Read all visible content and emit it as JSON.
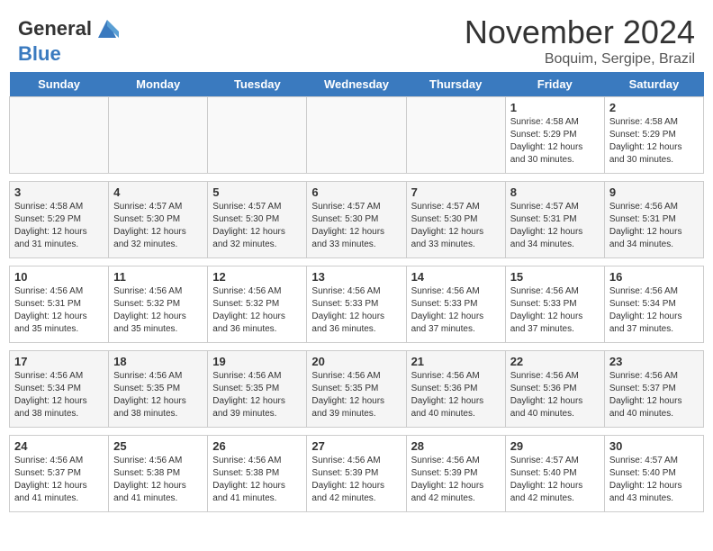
{
  "header": {
    "logo_general": "General",
    "logo_blue": "Blue",
    "month_year": "November 2024",
    "location": "Boquim, Sergipe, Brazil"
  },
  "weekdays": [
    "Sunday",
    "Monday",
    "Tuesday",
    "Wednesday",
    "Thursday",
    "Friday",
    "Saturday"
  ],
  "weeks": [
    {
      "days": [
        {
          "num": "",
          "info": ""
        },
        {
          "num": "",
          "info": ""
        },
        {
          "num": "",
          "info": ""
        },
        {
          "num": "",
          "info": ""
        },
        {
          "num": "",
          "info": ""
        },
        {
          "num": "1",
          "info": "Sunrise: 4:58 AM\nSunset: 5:29 PM\nDaylight: 12 hours\nand 30 minutes."
        },
        {
          "num": "2",
          "info": "Sunrise: 4:58 AM\nSunset: 5:29 PM\nDaylight: 12 hours\nand 30 minutes."
        }
      ]
    },
    {
      "days": [
        {
          "num": "3",
          "info": "Sunrise: 4:58 AM\nSunset: 5:29 PM\nDaylight: 12 hours\nand 31 minutes."
        },
        {
          "num": "4",
          "info": "Sunrise: 4:57 AM\nSunset: 5:30 PM\nDaylight: 12 hours\nand 32 minutes."
        },
        {
          "num": "5",
          "info": "Sunrise: 4:57 AM\nSunset: 5:30 PM\nDaylight: 12 hours\nand 32 minutes."
        },
        {
          "num": "6",
          "info": "Sunrise: 4:57 AM\nSunset: 5:30 PM\nDaylight: 12 hours\nand 33 minutes."
        },
        {
          "num": "7",
          "info": "Sunrise: 4:57 AM\nSunset: 5:30 PM\nDaylight: 12 hours\nand 33 minutes."
        },
        {
          "num": "8",
          "info": "Sunrise: 4:57 AM\nSunset: 5:31 PM\nDaylight: 12 hours\nand 34 minutes."
        },
        {
          "num": "9",
          "info": "Sunrise: 4:56 AM\nSunset: 5:31 PM\nDaylight: 12 hours\nand 34 minutes."
        }
      ]
    },
    {
      "days": [
        {
          "num": "10",
          "info": "Sunrise: 4:56 AM\nSunset: 5:31 PM\nDaylight: 12 hours\nand 35 minutes."
        },
        {
          "num": "11",
          "info": "Sunrise: 4:56 AM\nSunset: 5:32 PM\nDaylight: 12 hours\nand 35 minutes."
        },
        {
          "num": "12",
          "info": "Sunrise: 4:56 AM\nSunset: 5:32 PM\nDaylight: 12 hours\nand 36 minutes."
        },
        {
          "num": "13",
          "info": "Sunrise: 4:56 AM\nSunset: 5:33 PM\nDaylight: 12 hours\nand 36 minutes."
        },
        {
          "num": "14",
          "info": "Sunrise: 4:56 AM\nSunset: 5:33 PM\nDaylight: 12 hours\nand 37 minutes."
        },
        {
          "num": "15",
          "info": "Sunrise: 4:56 AM\nSunset: 5:33 PM\nDaylight: 12 hours\nand 37 minutes."
        },
        {
          "num": "16",
          "info": "Sunrise: 4:56 AM\nSunset: 5:34 PM\nDaylight: 12 hours\nand 37 minutes."
        }
      ]
    },
    {
      "days": [
        {
          "num": "17",
          "info": "Sunrise: 4:56 AM\nSunset: 5:34 PM\nDaylight: 12 hours\nand 38 minutes."
        },
        {
          "num": "18",
          "info": "Sunrise: 4:56 AM\nSunset: 5:35 PM\nDaylight: 12 hours\nand 38 minutes."
        },
        {
          "num": "19",
          "info": "Sunrise: 4:56 AM\nSunset: 5:35 PM\nDaylight: 12 hours\nand 39 minutes."
        },
        {
          "num": "20",
          "info": "Sunrise: 4:56 AM\nSunset: 5:35 PM\nDaylight: 12 hours\nand 39 minutes."
        },
        {
          "num": "21",
          "info": "Sunrise: 4:56 AM\nSunset: 5:36 PM\nDaylight: 12 hours\nand 40 minutes."
        },
        {
          "num": "22",
          "info": "Sunrise: 4:56 AM\nSunset: 5:36 PM\nDaylight: 12 hours\nand 40 minutes."
        },
        {
          "num": "23",
          "info": "Sunrise: 4:56 AM\nSunset: 5:37 PM\nDaylight: 12 hours\nand 40 minutes."
        }
      ]
    },
    {
      "days": [
        {
          "num": "24",
          "info": "Sunrise: 4:56 AM\nSunset: 5:37 PM\nDaylight: 12 hours\nand 41 minutes."
        },
        {
          "num": "25",
          "info": "Sunrise: 4:56 AM\nSunset: 5:38 PM\nDaylight: 12 hours\nand 41 minutes."
        },
        {
          "num": "26",
          "info": "Sunrise: 4:56 AM\nSunset: 5:38 PM\nDaylight: 12 hours\nand 41 minutes."
        },
        {
          "num": "27",
          "info": "Sunrise: 4:56 AM\nSunset: 5:39 PM\nDaylight: 12 hours\nand 42 minutes."
        },
        {
          "num": "28",
          "info": "Sunrise: 4:56 AM\nSunset: 5:39 PM\nDaylight: 12 hours\nand 42 minutes."
        },
        {
          "num": "29",
          "info": "Sunrise: 4:57 AM\nSunset: 5:40 PM\nDaylight: 12 hours\nand 42 minutes."
        },
        {
          "num": "30",
          "info": "Sunrise: 4:57 AM\nSunset: 5:40 PM\nDaylight: 12 hours\nand 43 minutes."
        }
      ]
    }
  ]
}
